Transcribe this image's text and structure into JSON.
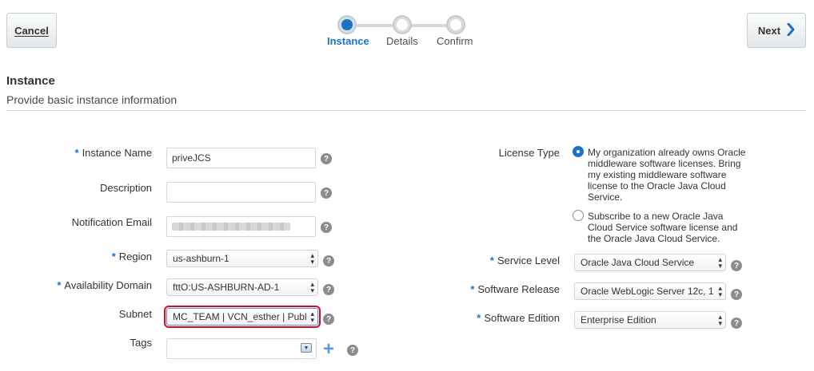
{
  "toolbar": {
    "cancel_label": "Cancel",
    "next_label": "Next"
  },
  "train": {
    "steps": [
      {
        "label": "Instance",
        "state": "active"
      },
      {
        "label": "Details",
        "state": "inactive"
      },
      {
        "label": "Confirm",
        "state": "inactive"
      }
    ]
  },
  "section": {
    "title": "Instance",
    "subtitle": "Provide basic instance information"
  },
  "left_form": {
    "instance_name": {
      "label": "Instance Name",
      "required": true,
      "value": "priveJCS"
    },
    "description": {
      "label": "Description",
      "required": false,
      "value": ""
    },
    "notification_email": {
      "label": "Notification Email",
      "required": false,
      "value": "(redacted)"
    },
    "region": {
      "label": "Region",
      "required": true,
      "value": "us-ashburn-1"
    },
    "availability_domain": {
      "label": "Availability Domain",
      "required": true,
      "value": "fttO:US-ASHBURN-AD-1"
    },
    "subnet": {
      "label": "Subnet",
      "required": false,
      "value": "MC_TEAM | VCN_esther | Publ"
    },
    "tags": {
      "label": "Tags",
      "required": false,
      "value": ""
    }
  },
  "right_form": {
    "license_type": {
      "label": "License Type",
      "options": [
        {
          "text": "My organization already owns Oracle middleware software licenses. Bring my existing middleware software license to the Oracle Java Cloud Service.",
          "checked": true
        },
        {
          "text": "Subscribe to a new Oracle Java Cloud Service software license and the Oracle Java Cloud Service.",
          "checked": false
        }
      ]
    },
    "service_level": {
      "label": "Service Level",
      "required": true,
      "value": "Oracle Java Cloud Service"
    },
    "software_release": {
      "label": "Software Release",
      "required": true,
      "value": "Oracle WebLogic Server 12c, 1"
    },
    "software_edition": {
      "label": "Software Edition",
      "required": true,
      "value": "Enterprise Edition"
    }
  },
  "icons": {
    "help": "question-circle-icon",
    "next": "chevron-right-icon",
    "add": "plus-icon",
    "dropdown": "dropdown-arrow-icon"
  },
  "colors": {
    "accent": "#1a73c8",
    "focus_outline": "#c8102e",
    "help_icon": "#8a8d8f"
  }
}
